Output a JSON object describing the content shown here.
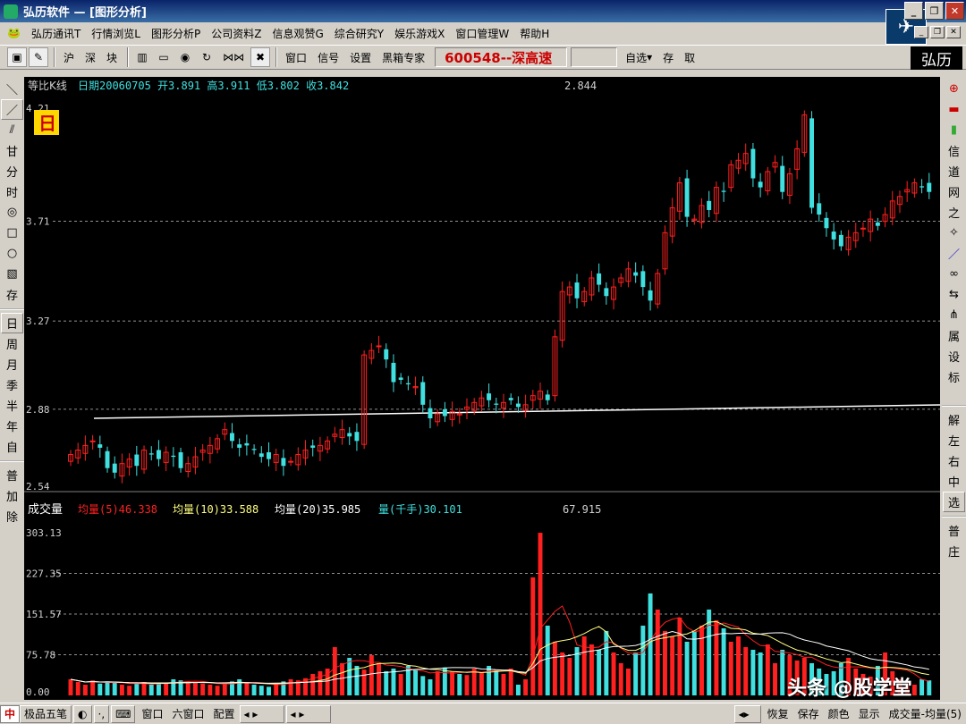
{
  "window": {
    "title": "弘历软件 — [图形分析]",
    "logo_text": "弘历"
  },
  "menu": [
    "弘历通讯T",
    "行情浏览L",
    "图形分析P",
    "公司资料Z",
    "信息观赞G",
    "综合研究Y",
    "娱乐游戏X",
    "窗口管理W",
    "帮助H"
  ],
  "toolbar": {
    "buttons": [
      "沪",
      "深",
      "块"
    ],
    "buttons2": [
      "窗口",
      "信号",
      "设置",
      "黑箱专家"
    ],
    "stock": "600548--深高速",
    "right_buttons": [
      "自选",
      "存",
      "取"
    ]
  },
  "left_tools": [
    "甘",
    "分",
    "时",
    "存"
  ],
  "period_tools": [
    "日",
    "周",
    "月",
    "季",
    "半",
    "年",
    "自"
  ],
  "left_bottom": [
    "普",
    "加",
    "除"
  ],
  "right_tools": [
    "信",
    "道",
    "网",
    "之",
    "属",
    "设",
    "标"
  ],
  "right_bottom": [
    "解",
    "左",
    "右",
    "中",
    "选",
    "普",
    "庄"
  ],
  "price_panel": {
    "indicator": "等比K线",
    "info": "日期20060705  开3.891  高3.911  低3.802  收3.842",
    "extra_value": "2.844",
    "period_badge": "日",
    "y_ticks": [
      {
        "value": 4.21,
        "label": "4.21"
      },
      {
        "value": 3.71,
        "label": "3.71"
      },
      {
        "value": 3.27,
        "label": "3.27"
      },
      {
        "value": 2.88,
        "label": "2.88"
      },
      {
        "value": 2.54,
        "label": "2.54"
      }
    ],
    "ymin": 2.54,
    "ymax": 4.21
  },
  "volume_panel": {
    "title": "成交量",
    "ma5_label": "均量(5)46.338",
    "ma10_label": "均量(10)33.588",
    "ma20_label": "均量(20)35.985",
    "vol_label": "量(千手)30.101",
    "extra_value": "67.915",
    "y_ticks": [
      {
        "value": 303.13,
        "label": "303.13"
      },
      {
        "value": 227.35,
        "label": "227.35"
      },
      {
        "value": 151.57,
        "label": "151.57"
      },
      {
        "value": 75.78,
        "label": "75.78"
      },
      {
        "value": 0,
        "label": "0.00"
      }
    ],
    "ymax": 303.13
  },
  "statusbar": {
    "product": "极品五笔",
    "items": [
      "窗口",
      "六窗口",
      "配置"
    ],
    "right_items": [
      "恢复",
      "保存",
      "颜色",
      "显示"
    ],
    "indicator": "成交量-均量(5)"
  },
  "watermark": "头条 @股学堂",
  "colors": {
    "up": "#ff2020",
    "down": "#40e0e0",
    "grid": "#c0c0c0"
  },
  "chart_data": {
    "type": "candlestick",
    "closes": [
      2.68,
      2.7,
      2.72,
      2.74,
      2.71,
      2.62,
      2.6,
      2.64,
      2.66,
      2.63,
      2.7,
      2.68,
      2.66,
      2.69,
      2.67,
      2.62,
      2.64,
      2.67,
      2.7,
      2.72,
      2.75,
      2.79,
      2.74,
      2.71,
      2.72,
      2.7,
      2.67,
      2.66,
      2.68,
      2.63,
      2.65,
      2.68,
      2.7,
      2.71,
      2.72,
      2.74,
      2.77,
      2.79,
      2.76,
      2.74,
      3.12,
      3.14,
      3.16,
      3.1,
      3.0,
      3.01,
      2.99,
      2.98,
      2.9,
      2.84,
      2.86,
      2.85,
      2.87,
      2.86,
      2.89,
      2.91,
      2.93,
      2.92,
      2.9,
      2.91,
      2.92,
      2.89,
      2.9,
      2.94,
      2.96,
      2.92,
      3.2,
      3.4,
      3.42,
      3.37,
      3.4,
      3.46,
      3.43,
      3.38,
      3.42,
      3.46,
      3.5,
      3.47,
      3.42,
      3.36,
      3.48,
      3.66,
      3.77,
      3.88,
      3.73,
      3.72,
      3.78,
      3.76,
      3.86,
      3.84,
      3.96,
      3.98,
      4.01,
      3.9,
      3.86,
      3.93,
      3.97,
      3.84,
      3.92,
      4.03,
      4.18,
      3.77,
      3.74,
      3.68,
      3.63,
      3.6,
      3.64,
      3.66,
      3.68,
      3.72,
      3.69,
      3.74,
      3.8,
      3.82,
      3.85,
      3.88,
      3.86,
      3.84
    ],
    "volumes": [
      30,
      25,
      20,
      28,
      22,
      26,
      24,
      20,
      18,
      22,
      25,
      20,
      22,
      24,
      30,
      28,
      26,
      24,
      22,
      20,
      18,
      22,
      26,
      30,
      24,
      20,
      18,
      16,
      22,
      26,
      30,
      28,
      32,
      40,
      45,
      50,
      90,
      60,
      70,
      55,
      48,
      75,
      60,
      45,
      50,
      40,
      55,
      48,
      36,
      30,
      45,
      52,
      44,
      40,
      38,
      50,
      42,
      55,
      48,
      40,
      50,
      20,
      30,
      220,
      303,
      130,
      100,
      80,
      70,
      90,
      110,
      95,
      85,
      120,
      80,
      60,
      50,
      80,
      130,
      190,
      160,
      120,
      110,
      145,
      100,
      120,
      130,
      160,
      140,
      125,
      100,
      110,
      90,
      85,
      80,
      95,
      60,
      85,
      75,
      65,
      70,
      60,
      50,
      40,
      45,
      60,
      70,
      50,
      40,
      35,
      55,
      80,
      45,
      30,
      25,
      20,
      30,
      28
    ]
  }
}
